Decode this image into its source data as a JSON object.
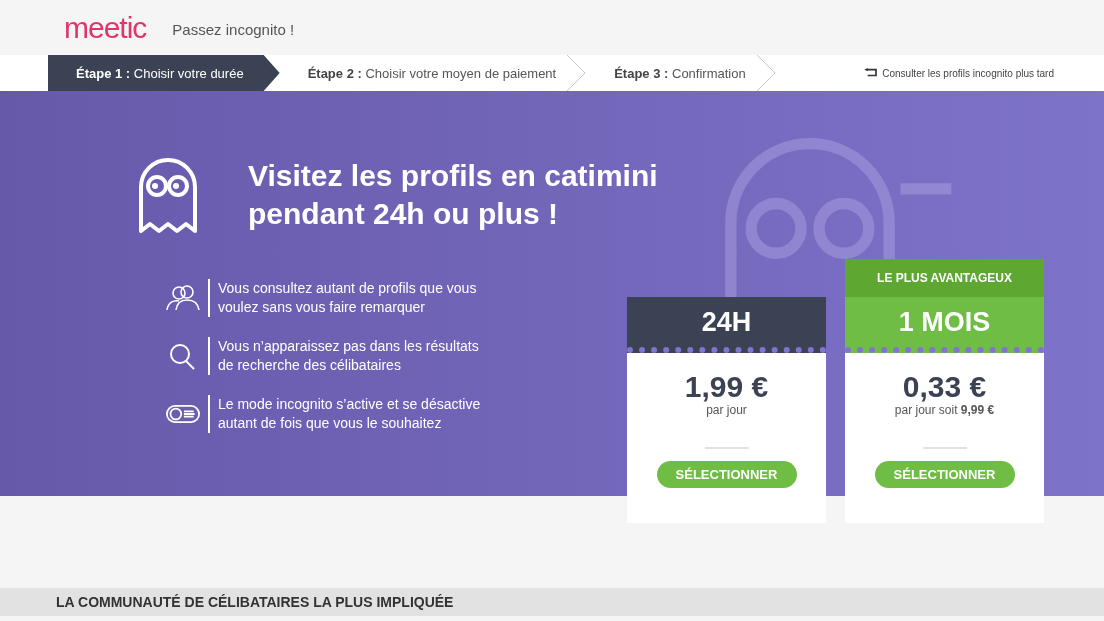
{
  "header": {
    "logo": "meetic",
    "title": "Passez incognito !"
  },
  "steps": [
    {
      "number": "Étape 1 :",
      "label": "Choisir votre durée",
      "selected": true
    },
    {
      "number": "Étape 2 :",
      "label": "Choisir votre moyen de paiement",
      "selected": false
    },
    {
      "number": "Étape 3 :",
      "label": "Confirmation",
      "selected": false
    }
  ],
  "later_link": "Consulter les profils incognito plus tard",
  "hero": {
    "title": "Visitez les profils en catimini pendant 24h ou plus !"
  },
  "features": [
    {
      "kind": "people",
      "text": "Vous consultez autant de profils que vous voulez sans vous faire remarquer"
    },
    {
      "kind": "search",
      "text": "Vous n’apparaissez pas dans les résultats de recherche des célibataires"
    },
    {
      "kind": "toggle",
      "text": "Le mode incognito s’active et se désactive autant de fois que vous le souhaitez"
    }
  ],
  "offers": [
    {
      "duration": "24H",
      "price": "1,99 €",
      "unit": "par jour",
      "button": "SÉLECTIONNER",
      "highlighted": false
    },
    {
      "badge": "LE PLUS AVANTAGEUX",
      "duration": "1 MOIS",
      "price": "0,33 €",
      "unit": "par jour soit **9,99 €**",
      "button": "SÉLECTIONNER",
      "highlighted": true
    }
  ],
  "section_title": "LA COMMUNAUTÉ DE CÉLIBATAIRES LA PLUS IMPLIQUÉE"
}
